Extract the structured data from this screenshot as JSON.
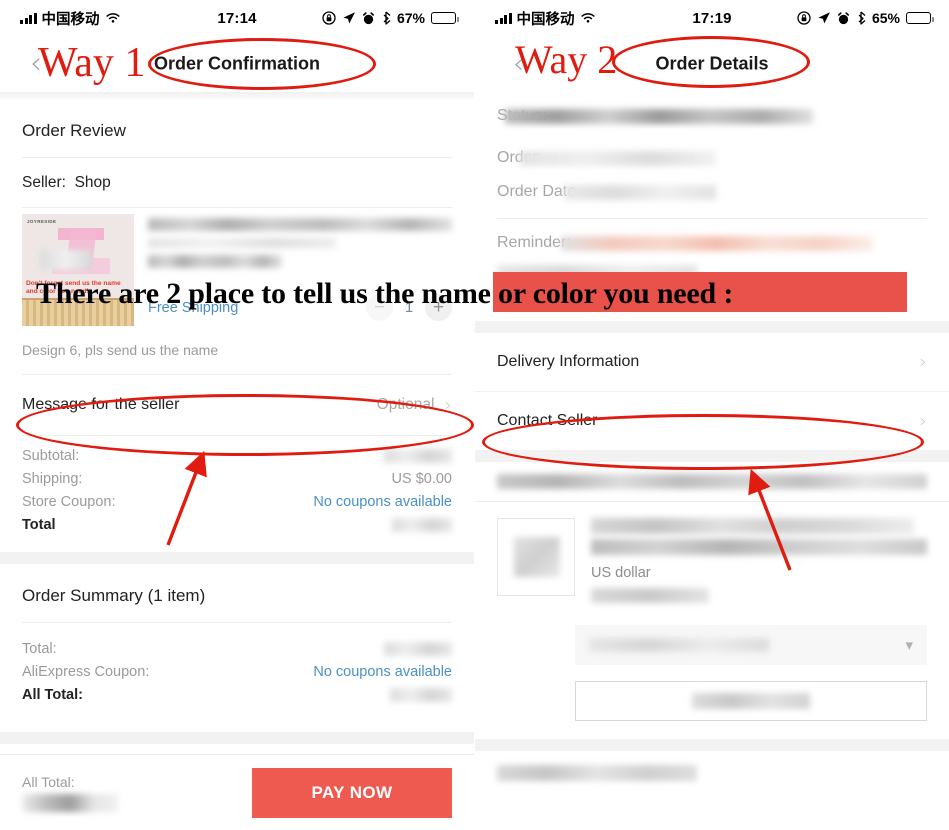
{
  "annotation": {
    "way1_label": "Way 1",
    "way2_label": "Way 2",
    "headline": "There are 2 place to tell us the name or color you need :",
    "ellipse_color": "#e01b10",
    "band_color": "#e8524a"
  },
  "left_phone": {
    "status_bar": {
      "carrier": "中国移动",
      "time": "17:14",
      "battery_percent": "67%",
      "icons": [
        "signal-bars-icon",
        "wifi-icon",
        "rotation-lock-icon",
        "location-arrow-icon",
        "alarm-clock-icon",
        "bluetooth-icon",
        "battery-icon"
      ]
    },
    "navbar": {
      "back_glyph": "‹",
      "title": "Order Confirmation"
    },
    "order_review": {
      "heading": "Order Review",
      "seller_label": "Seller:",
      "seller_name": "Shop"
    },
    "product": {
      "thumb_brand": "JOYRESIDE",
      "thumb_note": "Don't forget send us the name and color you need!",
      "free_shipping": "Free Shipping",
      "qty_minus": "−",
      "qty_value": "1",
      "qty_plus": "+",
      "note": "Design 6, pls send us the name"
    },
    "message_row": {
      "label": "Message for the seller",
      "value": "Optional",
      "chevron": "›"
    },
    "price_lines": [
      {
        "label": "Subtotal:",
        "value": "",
        "blurred": true,
        "link": false
      },
      {
        "label": "Shipping:",
        "value": "US $0.00",
        "blurred": false,
        "link": false
      },
      {
        "label": "Store Coupon:",
        "value": "No coupons available",
        "blurred": false,
        "link": true
      },
      {
        "label": "Total",
        "value": "",
        "blurred": true,
        "link": false,
        "bold": true
      }
    ],
    "order_summary": {
      "heading": "Order Summary (1 item)",
      "lines": [
        {
          "label": "Total:",
          "value": "",
          "blurred": true,
          "link": false
        },
        {
          "label": "AliExpress Coupon:",
          "value": "No coupons available",
          "blurred": false,
          "link": true
        },
        {
          "label": "All Total:",
          "value": "",
          "blurred": true,
          "link": false,
          "bold": true
        }
      ]
    },
    "footer": {
      "total_label": "All Total:",
      "pay_button": "PAY NOW"
    }
  },
  "right_phone": {
    "status_bar": {
      "carrier": "中国移动",
      "time": "17:19",
      "battery_percent": "65%",
      "icons": [
        "signal-bars-icon",
        "wifi-icon",
        "rotation-lock-icon",
        "location-arrow-icon",
        "alarm-clock-icon",
        "bluetooth-icon",
        "battery-icon"
      ]
    },
    "navbar": {
      "back_glyph": "‹",
      "title": "Order Details"
    },
    "details": [
      {
        "label": "Status:",
        "blurred": true
      },
      {
        "label": "Order",
        "blurred": true
      },
      {
        "label": "Order Date",
        "blurred": true
      },
      {
        "label": "Reminder:",
        "blurred": true
      }
    ],
    "list_rows": [
      {
        "label": "Delivery Information",
        "chevron": "›"
      },
      {
        "label": "Contact Seller",
        "chevron": "›"
      }
    ],
    "product": {
      "currency_note": "US dollar"
    }
  }
}
